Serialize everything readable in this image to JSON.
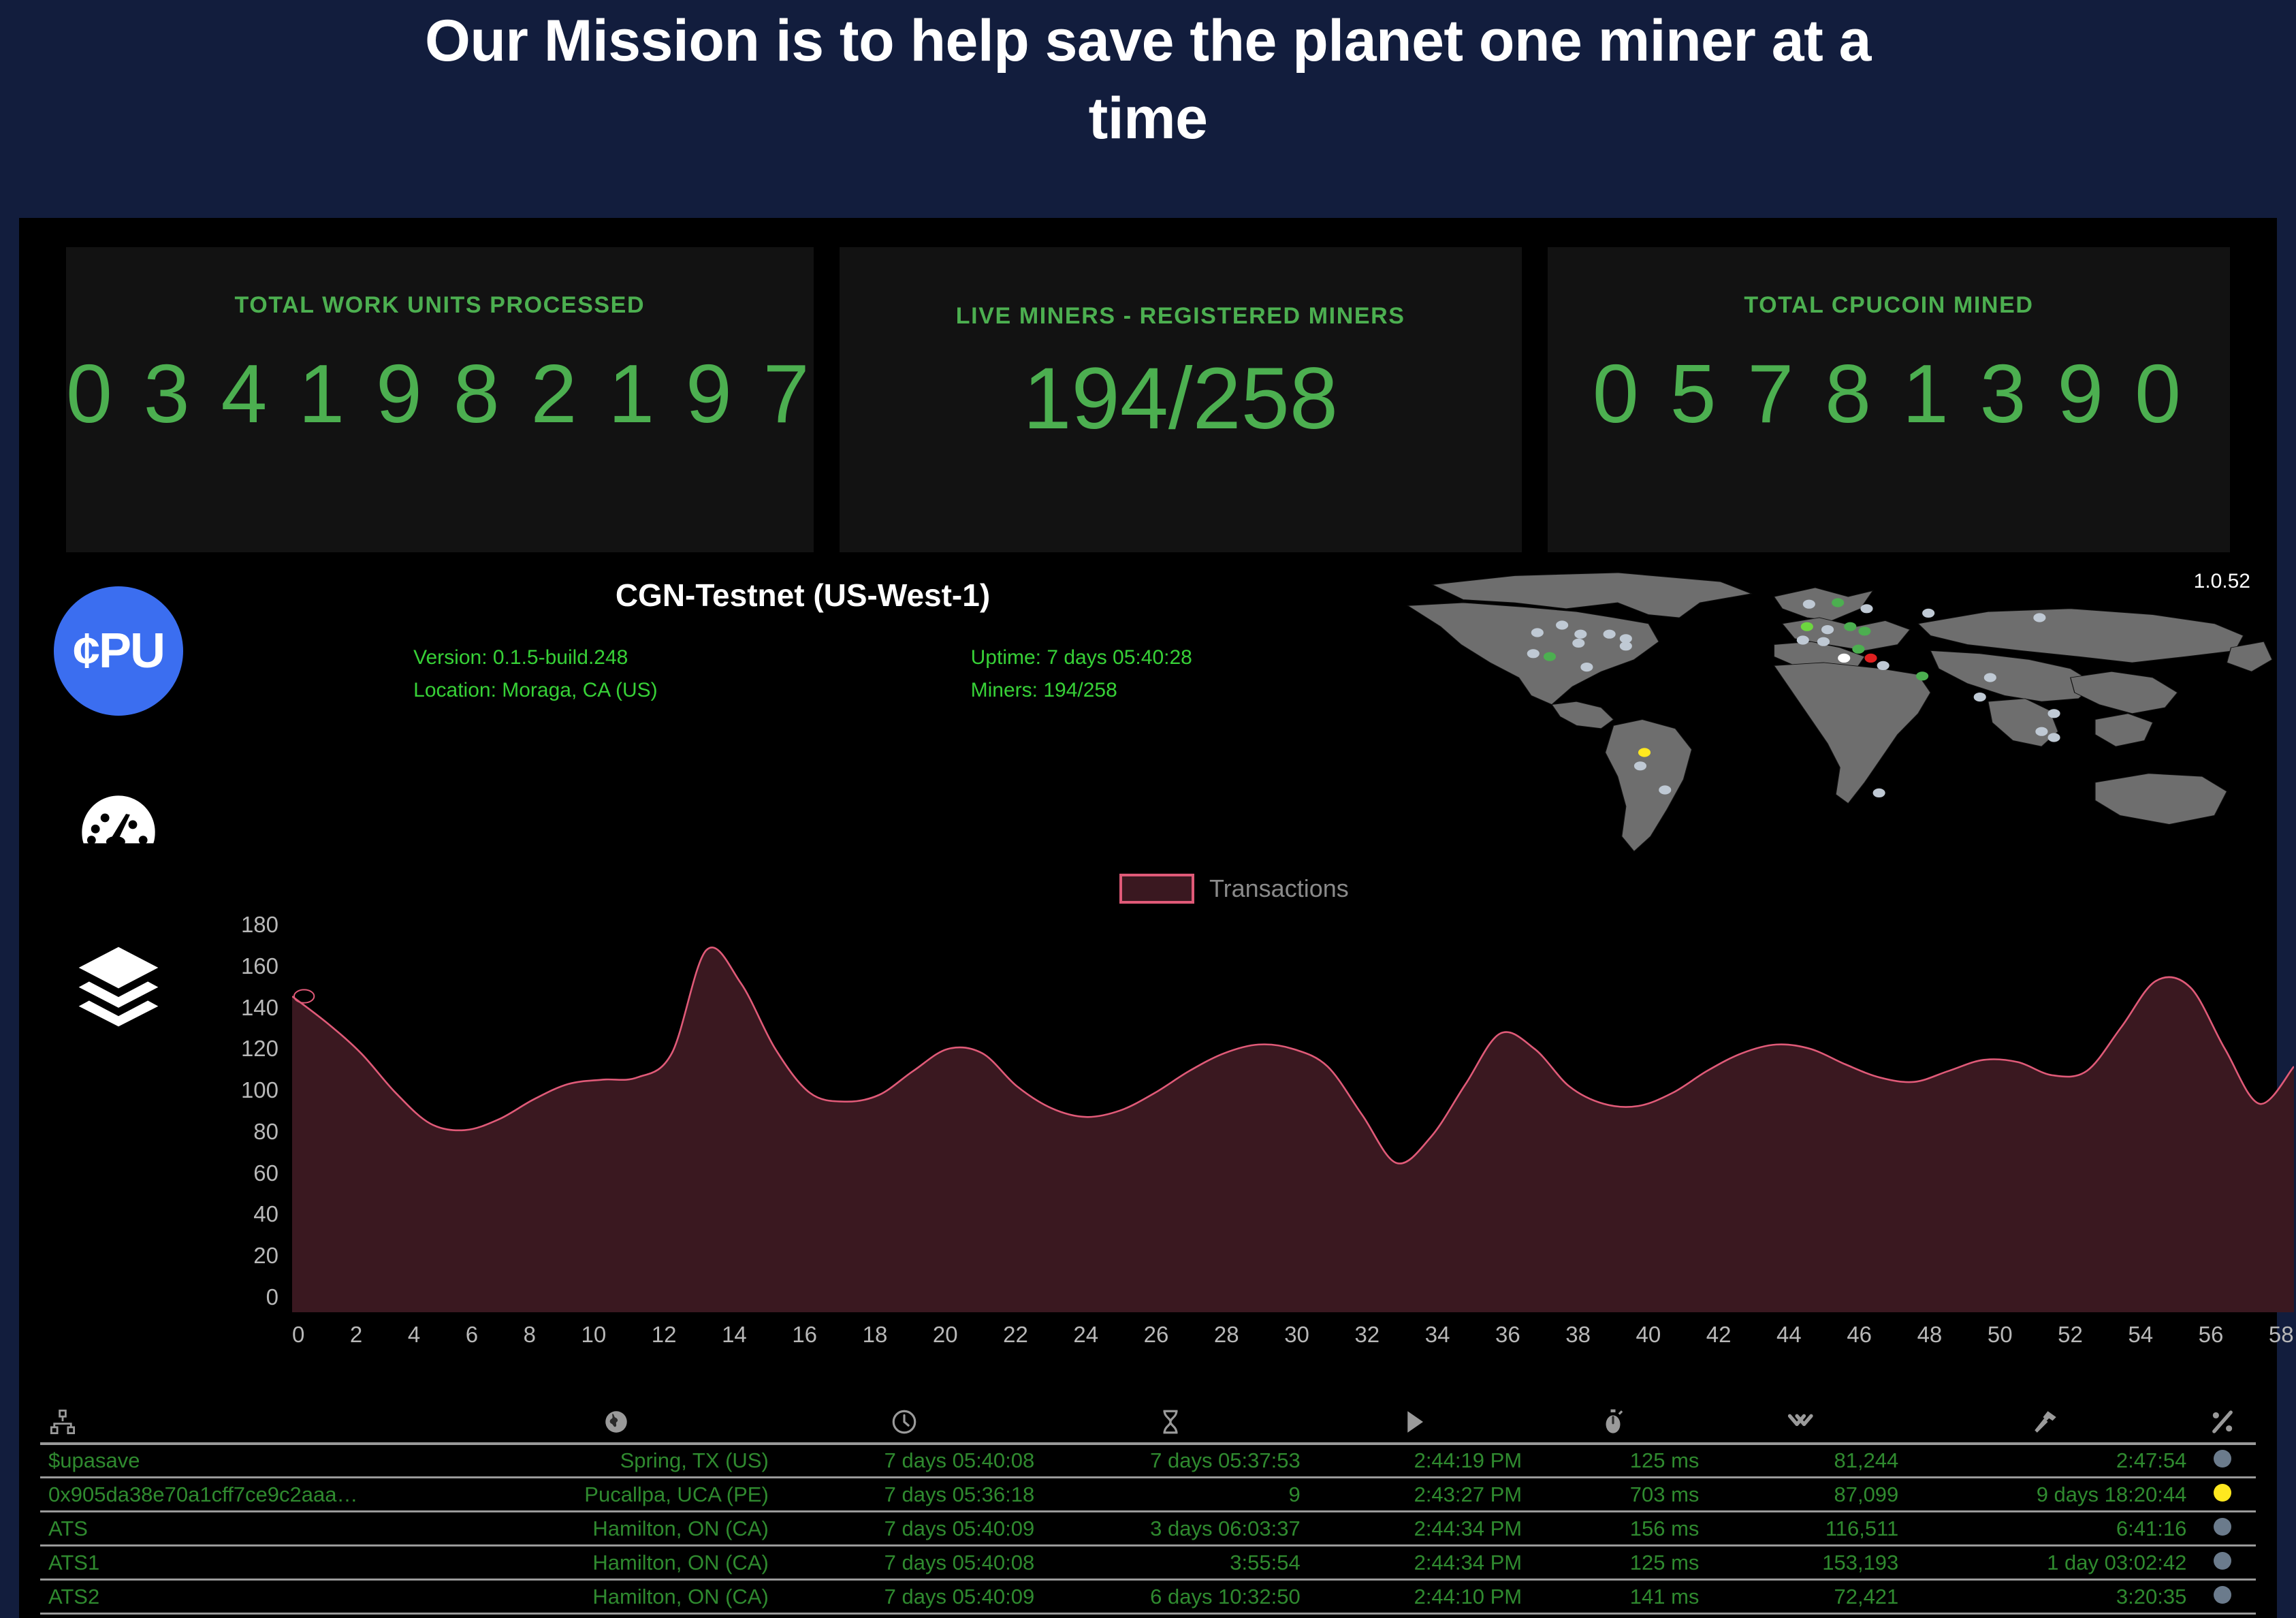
{
  "hero": {
    "title": "Our Mission is to help save the planet one miner at a time"
  },
  "stats": [
    {
      "label": "TOTAL WORK UNITS PROCESSED",
      "value": "0 3 4 1 9 8 2 1 9 7"
    },
    {
      "label": "LIVE MINERS - REGISTERED MINERS",
      "value": "194/258"
    },
    {
      "label": "TOTAL CPUCOIN MINED",
      "value": "0 5 7 8 1 3 9 0"
    }
  ],
  "sidebar": {
    "logo_text": "¢PU",
    "items": [
      {
        "icon": "cpu-coin-logo-icon",
        "name": "logo"
      },
      {
        "icon": "gauge-icon",
        "name": "dashboard"
      },
      {
        "icon": "layers-icon",
        "name": "blocks"
      }
    ]
  },
  "node": {
    "title": "CGN-Testnet (US-West-1)",
    "version": "Version: 0.1.5-build.248",
    "location": "Location: Moraga, CA (US)",
    "uptime": "Uptime: 7 days 05:40:28",
    "miners": "Miners: 194/258"
  },
  "map": {
    "version_badge": "1.0.52"
  },
  "legend": {
    "label": "Transactions",
    "color": "#e05a78",
    "fill": "#3a1820"
  },
  "chart_data": {
    "type": "area",
    "title": "",
    "xlabel": "",
    "ylabel": "",
    "legend": [
      "Transactions"
    ],
    "legend_position": "top-center",
    "grid": false,
    "xlim": [
      0,
      58
    ],
    "ylim": [
      0,
      180
    ],
    "xticks": [
      0,
      2,
      4,
      6,
      8,
      10,
      12,
      14,
      16,
      18,
      20,
      22,
      24,
      26,
      28,
      30,
      32,
      34,
      36,
      38,
      40,
      42,
      44,
      46,
      48,
      50,
      52,
      54,
      56,
      58
    ],
    "yticks": [
      0,
      20,
      40,
      60,
      80,
      100,
      120,
      140,
      160,
      180
    ],
    "series": [
      {
        "name": "Transactions",
        "color": "#e05a78",
        "fill": "#3a1820",
        "x": [
          0,
          1,
          2,
          3,
          4,
          5,
          6,
          7,
          8,
          9,
          10,
          11,
          12,
          13,
          14,
          15,
          16,
          17,
          18,
          19,
          20,
          21,
          22,
          23,
          24,
          25,
          26,
          27,
          28,
          29,
          30,
          31,
          32,
          33,
          34,
          35,
          36,
          37,
          38,
          39,
          40,
          41,
          42,
          43,
          44,
          45,
          46,
          47,
          48,
          49,
          50,
          51,
          52,
          53,
          54,
          55,
          56,
          57,
          58
        ],
        "values": [
          144,
          132,
          118,
          100,
          86,
          83,
          88,
          97,
          104,
          106,
          107,
          118,
          165,
          150,
          120,
          100,
          96,
          99,
          110,
          120,
          118,
          103,
          93,
          89,
          92,
          100,
          110,
          118,
          122,
          120,
          112,
          90,
          68,
          80,
          104,
          127,
          120,
          103,
          95,
          94,
          100,
          110,
          118,
          122,
          120,
          113,
          107,
          105,
          110,
          115,
          114,
          108,
          110,
          130,
          151,
          148,
          120,
          95,
          112
        ]
      }
    ]
  },
  "table": {
    "columns": [
      {
        "icon": "network-node-icon",
        "key": "name"
      },
      {
        "icon": "globe-icon",
        "key": "location"
      },
      {
        "icon": "clock-icon",
        "key": "uptime"
      },
      {
        "icon": "hourglass-icon",
        "key": "task_time"
      },
      {
        "icon": "play-icon",
        "key": "started"
      },
      {
        "icon": "stopwatch-icon",
        "key": "latency"
      },
      {
        "icon": "double-check-icon",
        "key": "work_units"
      },
      {
        "icon": "hammer-icon",
        "key": "last_mined"
      },
      {
        "icon": "percent-icon",
        "key": "status"
      }
    ],
    "rows": [
      {
        "name": "$upasave",
        "location": "Spring, TX (US)",
        "uptime": "7 days 05:40:08",
        "task_time": "7 days 05:37:53",
        "started": "2:44:19 PM",
        "latency": "125 ms",
        "work_units": "81,244",
        "last_mined": "2:47:54",
        "status_color": "#6b7b8c"
      },
      {
        "name": "0x905da38e70a1cff7ce9c2aaa…",
        "location": "Pucallpa, UCA (PE)",
        "uptime": "7 days 05:36:18",
        "task_time": "9",
        "started": "2:43:27 PM",
        "latency": "703 ms",
        "work_units": "87,099",
        "last_mined": "9 days 18:20:44",
        "status_color": "#ffe81f"
      },
      {
        "name": "ATS",
        "location": "Hamilton, ON (CA)",
        "uptime": "7 days 05:40:09",
        "task_time": "3 days 06:03:37",
        "started": "2:44:34 PM",
        "latency": "156 ms",
        "work_units": "116,511",
        "last_mined": "6:41:16",
        "status_color": "#6b7b8c"
      },
      {
        "name": "ATS1",
        "location": "Hamilton, ON (CA)",
        "uptime": "7 days 05:40:08",
        "task_time": "3:55:54",
        "started": "2:44:34 PM",
        "latency": "125 ms",
        "work_units": "153,193",
        "last_mined": "1 day 03:02:42",
        "status_color": "#6b7b8c"
      },
      {
        "name": "ATS2",
        "location": "Hamilton, ON (CA)",
        "uptime": "7 days 05:40:09",
        "task_time": "6 days 10:32:50",
        "started": "2:44:10 PM",
        "latency": "141 ms",
        "work_units": "72,421",
        "last_mined": "3:20:35",
        "status_color": "#6b7b8c"
      }
    ]
  }
}
